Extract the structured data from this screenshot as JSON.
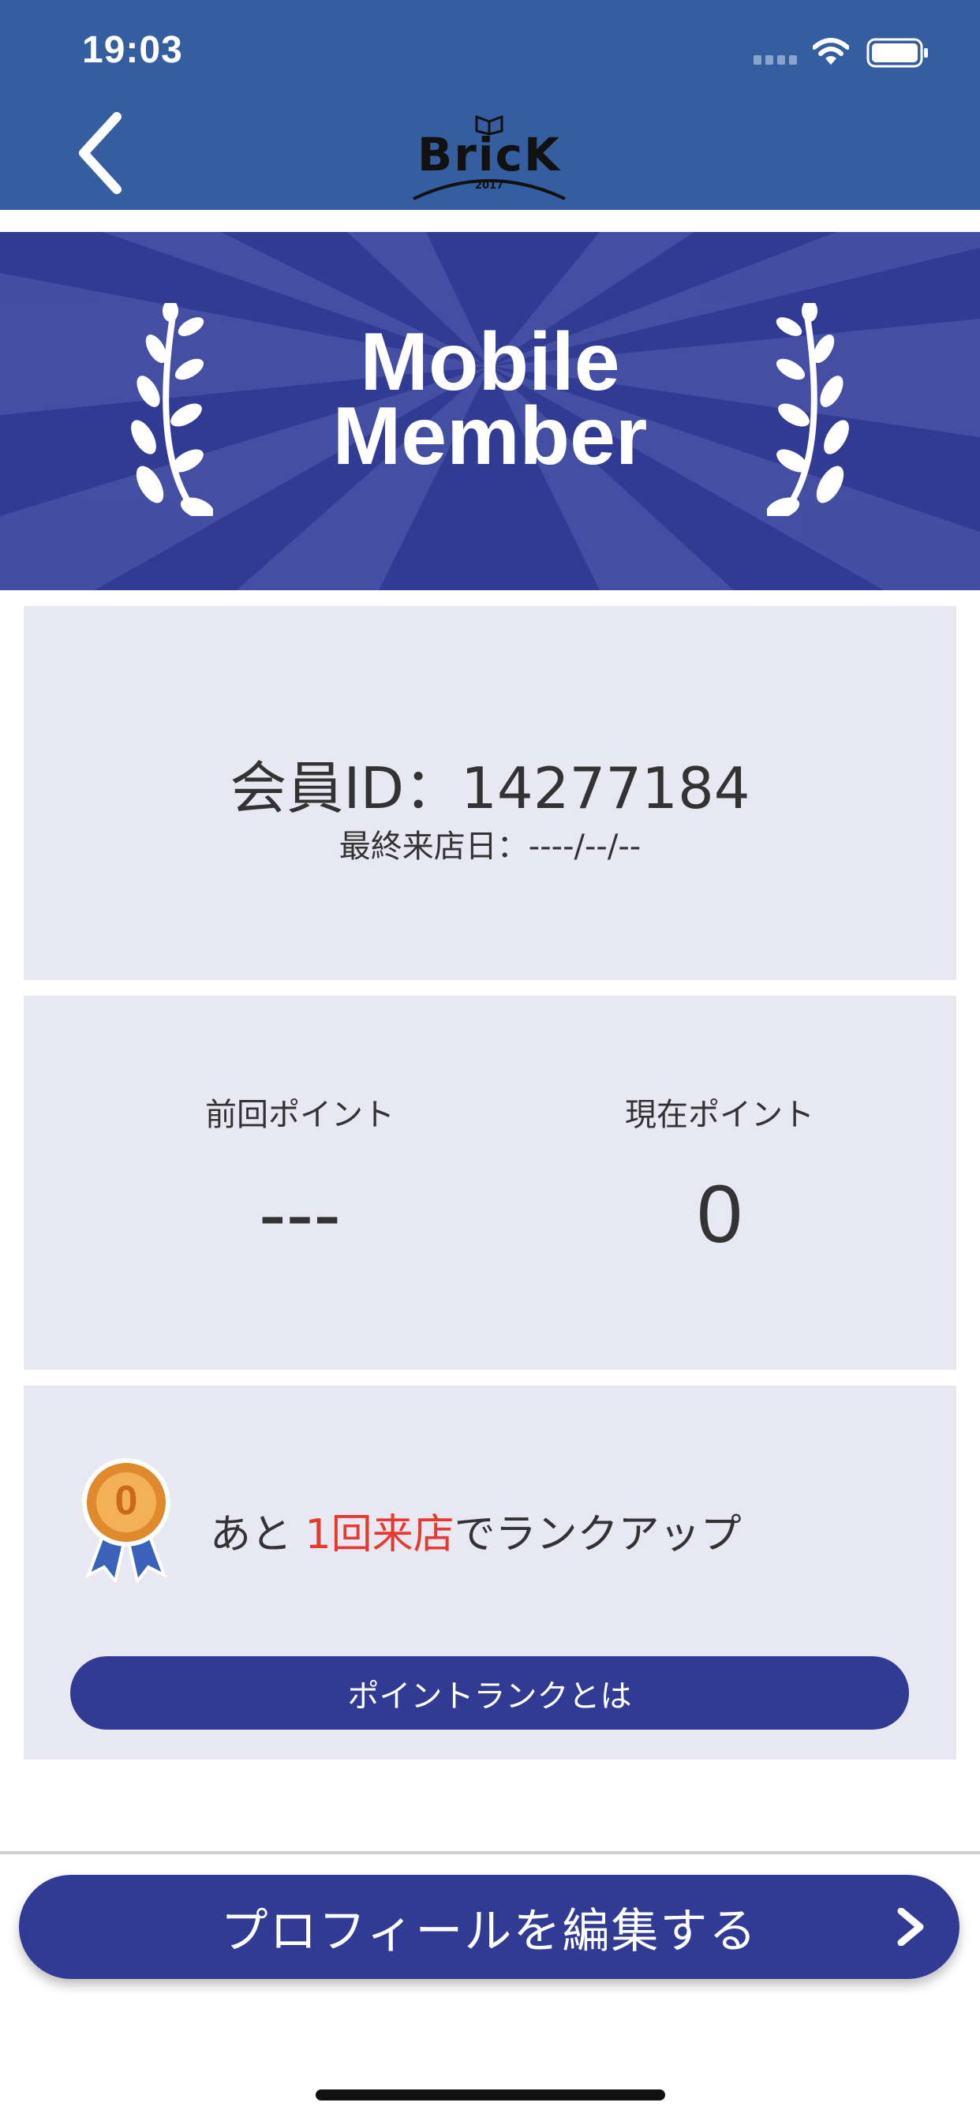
{
  "status_bar": {
    "time": "19:03"
  },
  "header": {
    "logo_text": "BricK",
    "logo_year": "2017"
  },
  "banner": {
    "title": "Mobile\nMember"
  },
  "member": {
    "id_label": "会員ID：14277184",
    "last_visit_label": "最終来店日：----/--/--"
  },
  "points": {
    "previous_label": "前回ポイント",
    "previous_value": "---",
    "current_label": "現在ポイント",
    "current_value": "0"
  },
  "rank": {
    "medal_value": "0",
    "message_prefix": "あと ",
    "message_highlight": "1回来店",
    "message_suffix": "でランクアップ",
    "info_button_label": "ポイントランクとは"
  },
  "footer": {
    "edit_profile_label": "プロフィールを編集する"
  },
  "colors": {
    "header_blue": "#345ea0",
    "brand_navy": "#323b94",
    "card_bg": "#e8e8f3",
    "highlight_red": "#e53a2f"
  }
}
